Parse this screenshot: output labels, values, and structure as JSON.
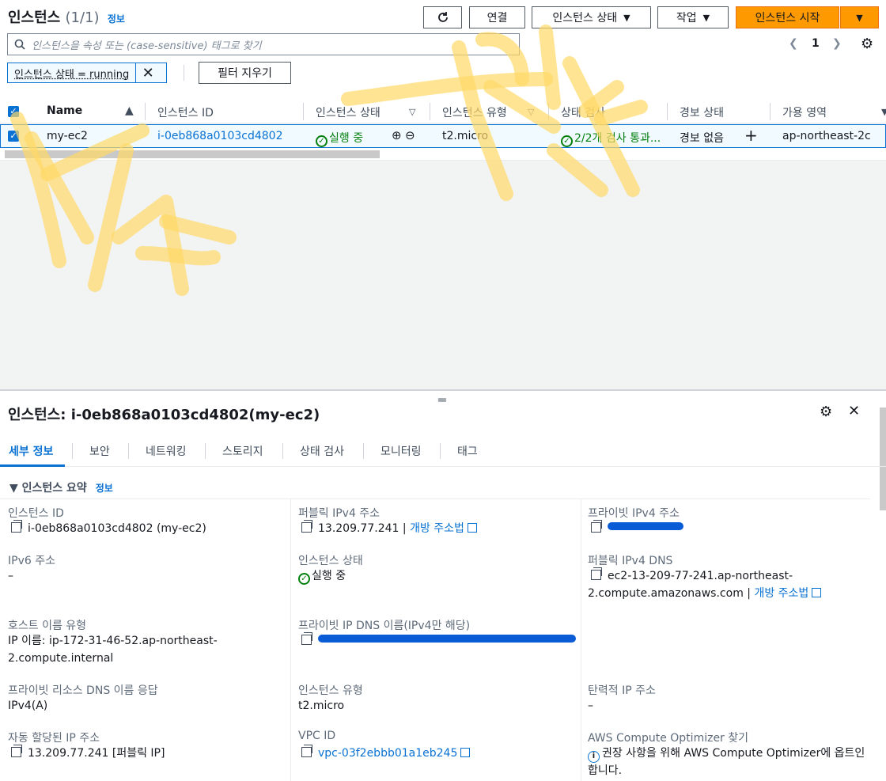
{
  "instances_panel": {
    "title": "인스턴스",
    "count": "(1/1)",
    "info_link": "정보",
    "buttons": {
      "connect": "연결",
      "instance_state": "인스턴스 상태",
      "actions": "작업",
      "launch": "인스턴스 시작"
    },
    "search_placeholder": "인스턴스을 속성 또는 (case-sensitive) 태그로 찾기",
    "page_number": "1",
    "filter_chip": "인스턴스 상태 = running",
    "clear_filters": "필터 지우기",
    "columns": [
      "Name",
      "인스턴스 ID",
      "인스턴스 상태",
      "인스턴스 유형",
      "상태 검사",
      "경보 상태",
      "가용 영역"
    ],
    "rows": [
      {
        "name": "my-ec2",
        "instance_id": "i-0eb868a0103cd4802",
        "state": "실행 중",
        "type": "t2.micro",
        "status_check": "2/2개 검사 통과...",
        "alarm": "경보 없음",
        "az": "ap-northeast-2c"
      }
    ]
  },
  "details": {
    "title": "인스턴스: i-0eb868a0103cd4802(my-ec2)",
    "tabs": [
      "세부 정보",
      "보안",
      "네트워킹",
      "스토리지",
      "상태 검사",
      "모니터링",
      "태그"
    ],
    "summary_title": "인스턴스 요약",
    "summary_info": "정보",
    "fields": {
      "instance_id_label": "인스턴스 ID",
      "instance_id_value": "i-0eb868a0103cd4802 (my-ec2)",
      "public_ipv4_label": "퍼블릭 IPv4 주소",
      "public_ipv4_value": "13.209.77.241",
      "open_address": "개방 주소법",
      "private_ipv4_label": "프라이빗 IPv4 주소",
      "ipv6_label": "IPv6 주소",
      "ipv6_value": "–",
      "state_label": "인스턴스 상태",
      "state_value": "실행 중",
      "public_dns_label": "퍼블릭 IPv4 DNS",
      "public_dns_line1": "ec2-13-209-77-241.ap-northeast-",
      "public_dns_line2": "2.compute.amazonaws.com |",
      "hostname_type_label": "호스트 이름 유형",
      "hostname_type_line1": "IP 이름: ip-172-31-46-52.ap-northeast-",
      "hostname_type_line2": "2.compute.internal",
      "private_dns_label": "프라이빗 IP DNS 이름(IPv4만 해당)",
      "private_dns_resp_label": "프라이빗 리소스 DNS 이름 응답",
      "private_dns_resp_value": "IPv4(A)",
      "type_label": "인스턴스 유형",
      "type_value": "t2.micro",
      "elastic_ip_label": "탄력적 IP 주소",
      "elastic_ip_value": "–",
      "auto_ip_label": "자동 할당된 IP 주소",
      "auto_ip_value": "13.209.77.241 [퍼블릭 IP]",
      "vpc_label": "VPC ID",
      "vpc_value": "vpc-03f2ebbb01a1eb245",
      "optimizer_label": "AWS Compute Optimizer 찾기",
      "optimizer_line1": "권장 사항을 위해 AWS Compute Optimizer에 옵트인",
      "optimizer_line2": "합니다."
    }
  },
  "colors": {
    "primary": "#ff9900",
    "link": "#0972d3",
    "success": "#037f0c",
    "highlight_scribble": "#ffd966"
  }
}
